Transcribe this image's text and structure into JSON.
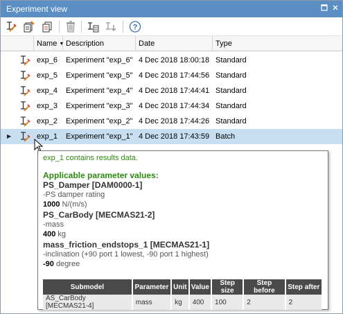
{
  "window": {
    "title": "Experiment view"
  },
  "toolbar": {
    "buttons": [
      {
        "icon": "new-experiment-icon"
      },
      {
        "icon": "new-batch-experiment-icon"
      },
      {
        "icon": "batch-experiment-icon"
      },
      {
        "icon": "delete-icon"
      },
      {
        "icon": "copy-to-experiment-icon"
      },
      {
        "icon": "export-experiment-icon"
      },
      {
        "icon": "help-icon",
        "glyph": "?"
      }
    ]
  },
  "table": {
    "columns": [
      "Name",
      "Description",
      "Date",
      "Type"
    ],
    "rows": [
      {
        "name": "exp_6",
        "description": "Experiment \"exp_6\"",
        "date": "4 Dec 2018 18:00:18",
        "type": "Standard"
      },
      {
        "name": "exp_5",
        "description": "Experiment \"exp_5\"",
        "date": "4 Dec 2018 17:44:56",
        "type": "Standard"
      },
      {
        "name": "exp_4",
        "description": "Experiment \"exp_4\"",
        "date": "4 Dec 2018 17:44:41",
        "type": "Standard"
      },
      {
        "name": "exp_3",
        "description": "Experiment \"exp_3\"",
        "date": "4 Dec 2018 17:44:34",
        "type": "Standard"
      },
      {
        "name": "exp_2",
        "description": "Experiment \"exp_2\"",
        "date": "4 Dec 2018 17:44:26",
        "type": "Standard"
      },
      {
        "name": "exp_1",
        "description": "Experiment \"exp_1\"",
        "date": "4 Dec 2018 17:43:59",
        "type": "Batch"
      }
    ],
    "selected_index": 5
  },
  "tooltip": {
    "summary": "exp_1 contains results data.",
    "heading": "Applicable parameter values:",
    "params": [
      {
        "title": "PS_Damper [DAM0000-1]",
        "desc": "-PS damper rating",
        "value": "1000",
        "unit": "N/(m/s)"
      },
      {
        "title": "PS_CarBody [MECMAS21-2]",
        "desc": "-mass",
        "value": "400",
        "unit": "kg"
      },
      {
        "title": "mass_friction_endstops_1 [MECMAS21-1]",
        "desc": "-inclination (+90 port 1 lowest, -90 port 1 highest)",
        "value": "-90",
        "unit": "degree"
      }
    ],
    "batch_table": {
      "headers": [
        "Submodel",
        "Parameter",
        "Unit",
        "Value",
        "Step size",
        "Step before",
        "Step after"
      ],
      "row": [
        "AS_CarBody [MECMAS21-4]",
        "mass",
        "kg",
        "400",
        "100",
        "2",
        "2"
      ]
    }
  },
  "colors": {
    "titlebar": "#5b8fc4",
    "selected_row": "#c7dff0",
    "tooltip_heading": "#2e8b12",
    "batch_header": "#4a4a4a"
  }
}
